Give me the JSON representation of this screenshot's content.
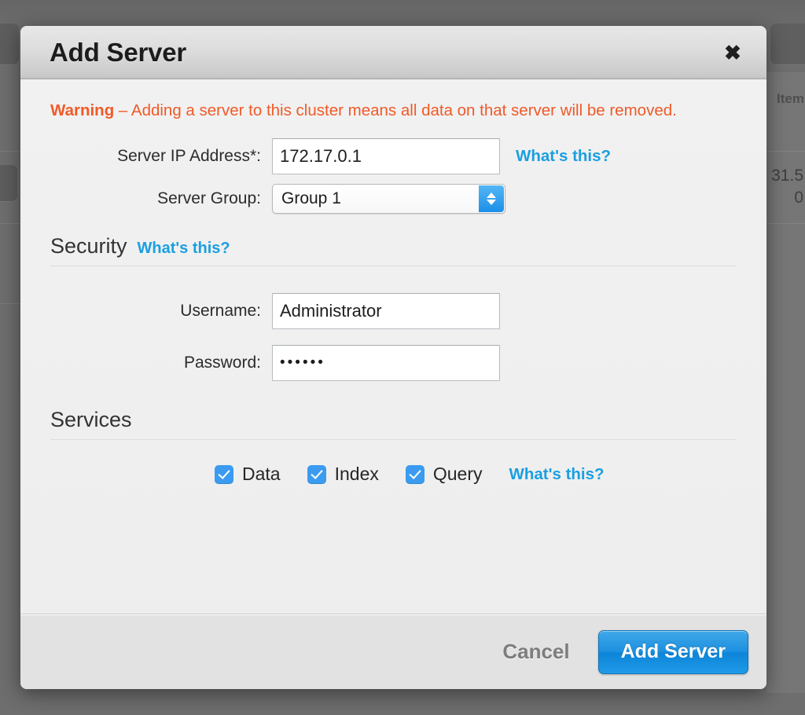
{
  "background": {
    "column_header": "Item",
    "values": [
      "31.5",
      "0"
    ]
  },
  "dialog": {
    "title": "Add Server",
    "close_icon": "close-icon",
    "warning": {
      "strong": "Warning",
      "text": " – Adding a server to this cluster means all data on that server will be removed.",
      "color": "#f05a28"
    },
    "fields": {
      "ip": {
        "label": "Server IP Address*:",
        "value": "172.17.0.1",
        "placeholder": "",
        "help_link": "What's this?"
      },
      "group": {
        "label": "Server Group:",
        "value": "Group 1",
        "options": [
          "Group 1"
        ]
      }
    },
    "security": {
      "heading": "Security",
      "help_link": "What's this?",
      "username": {
        "label": "Username:",
        "value": "Administrator",
        "placeholder": ""
      },
      "password": {
        "label": "Password:",
        "value": "••••••",
        "placeholder": ""
      }
    },
    "services": {
      "heading": "Services",
      "help_link": "What's this?",
      "items": [
        {
          "label": "Data",
          "checked": true
        },
        {
          "label": "Index",
          "checked": true
        },
        {
          "label": "Query",
          "checked": true
        }
      ]
    },
    "footer": {
      "cancel_label": "Cancel",
      "submit_label": "Add Server",
      "accent_color": "#1b8fe0"
    }
  }
}
